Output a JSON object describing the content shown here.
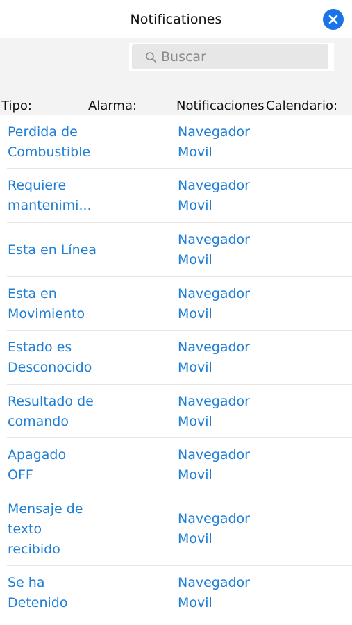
{
  "header": {
    "title": "Notificationes",
    "close_icon": "close-circle-icon",
    "accent": "#1a73e8"
  },
  "search": {
    "placeholder": "Buscar",
    "value": "",
    "icon": "search-icon"
  },
  "columns": {
    "tipo": "Tipo:",
    "alarma": "Alarma:",
    "notificaciones": "Notificaciones",
    "calendario": "Calendario:"
  },
  "link_color": "#1f7fd6",
  "rows": [
    {
      "tipo": [
        "Perdida de",
        "Combustible"
      ],
      "notificacion": [
        "Navegador",
        "Movil"
      ]
    },
    {
      "tipo": [
        "Requiere",
        "mantenimi..."
      ],
      "notificacion": [
        "Navegador",
        "Movil"
      ]
    },
    {
      "tipo": [
        "Esta en Línea"
      ],
      "notificacion": [
        "Navegador",
        "Movil"
      ]
    },
    {
      "tipo": [
        "Esta en",
        "Movimiento"
      ],
      "notificacion": [
        "Navegador",
        "Movil"
      ]
    },
    {
      "tipo": [
        "Estado es",
        "Desconocido"
      ],
      "notificacion": [
        "Navegador",
        "Movil"
      ]
    },
    {
      "tipo": [
        "Resultado de",
        "comando"
      ],
      "notificacion": [
        "Navegador",
        "Movil"
      ]
    },
    {
      "tipo": [
        "Apagado",
        "OFF"
      ],
      "notificacion": [
        "Navegador",
        "Movil"
      ]
    },
    {
      "tipo": [
        "Mensaje de",
        "texto",
        "recibido"
      ],
      "notificacion": [
        "Navegador",
        "Movil"
      ]
    },
    {
      "tipo": [
        "Se ha",
        "Detenido"
      ],
      "notificacion": [
        "Navegador",
        "Movil"
      ]
    }
  ]
}
